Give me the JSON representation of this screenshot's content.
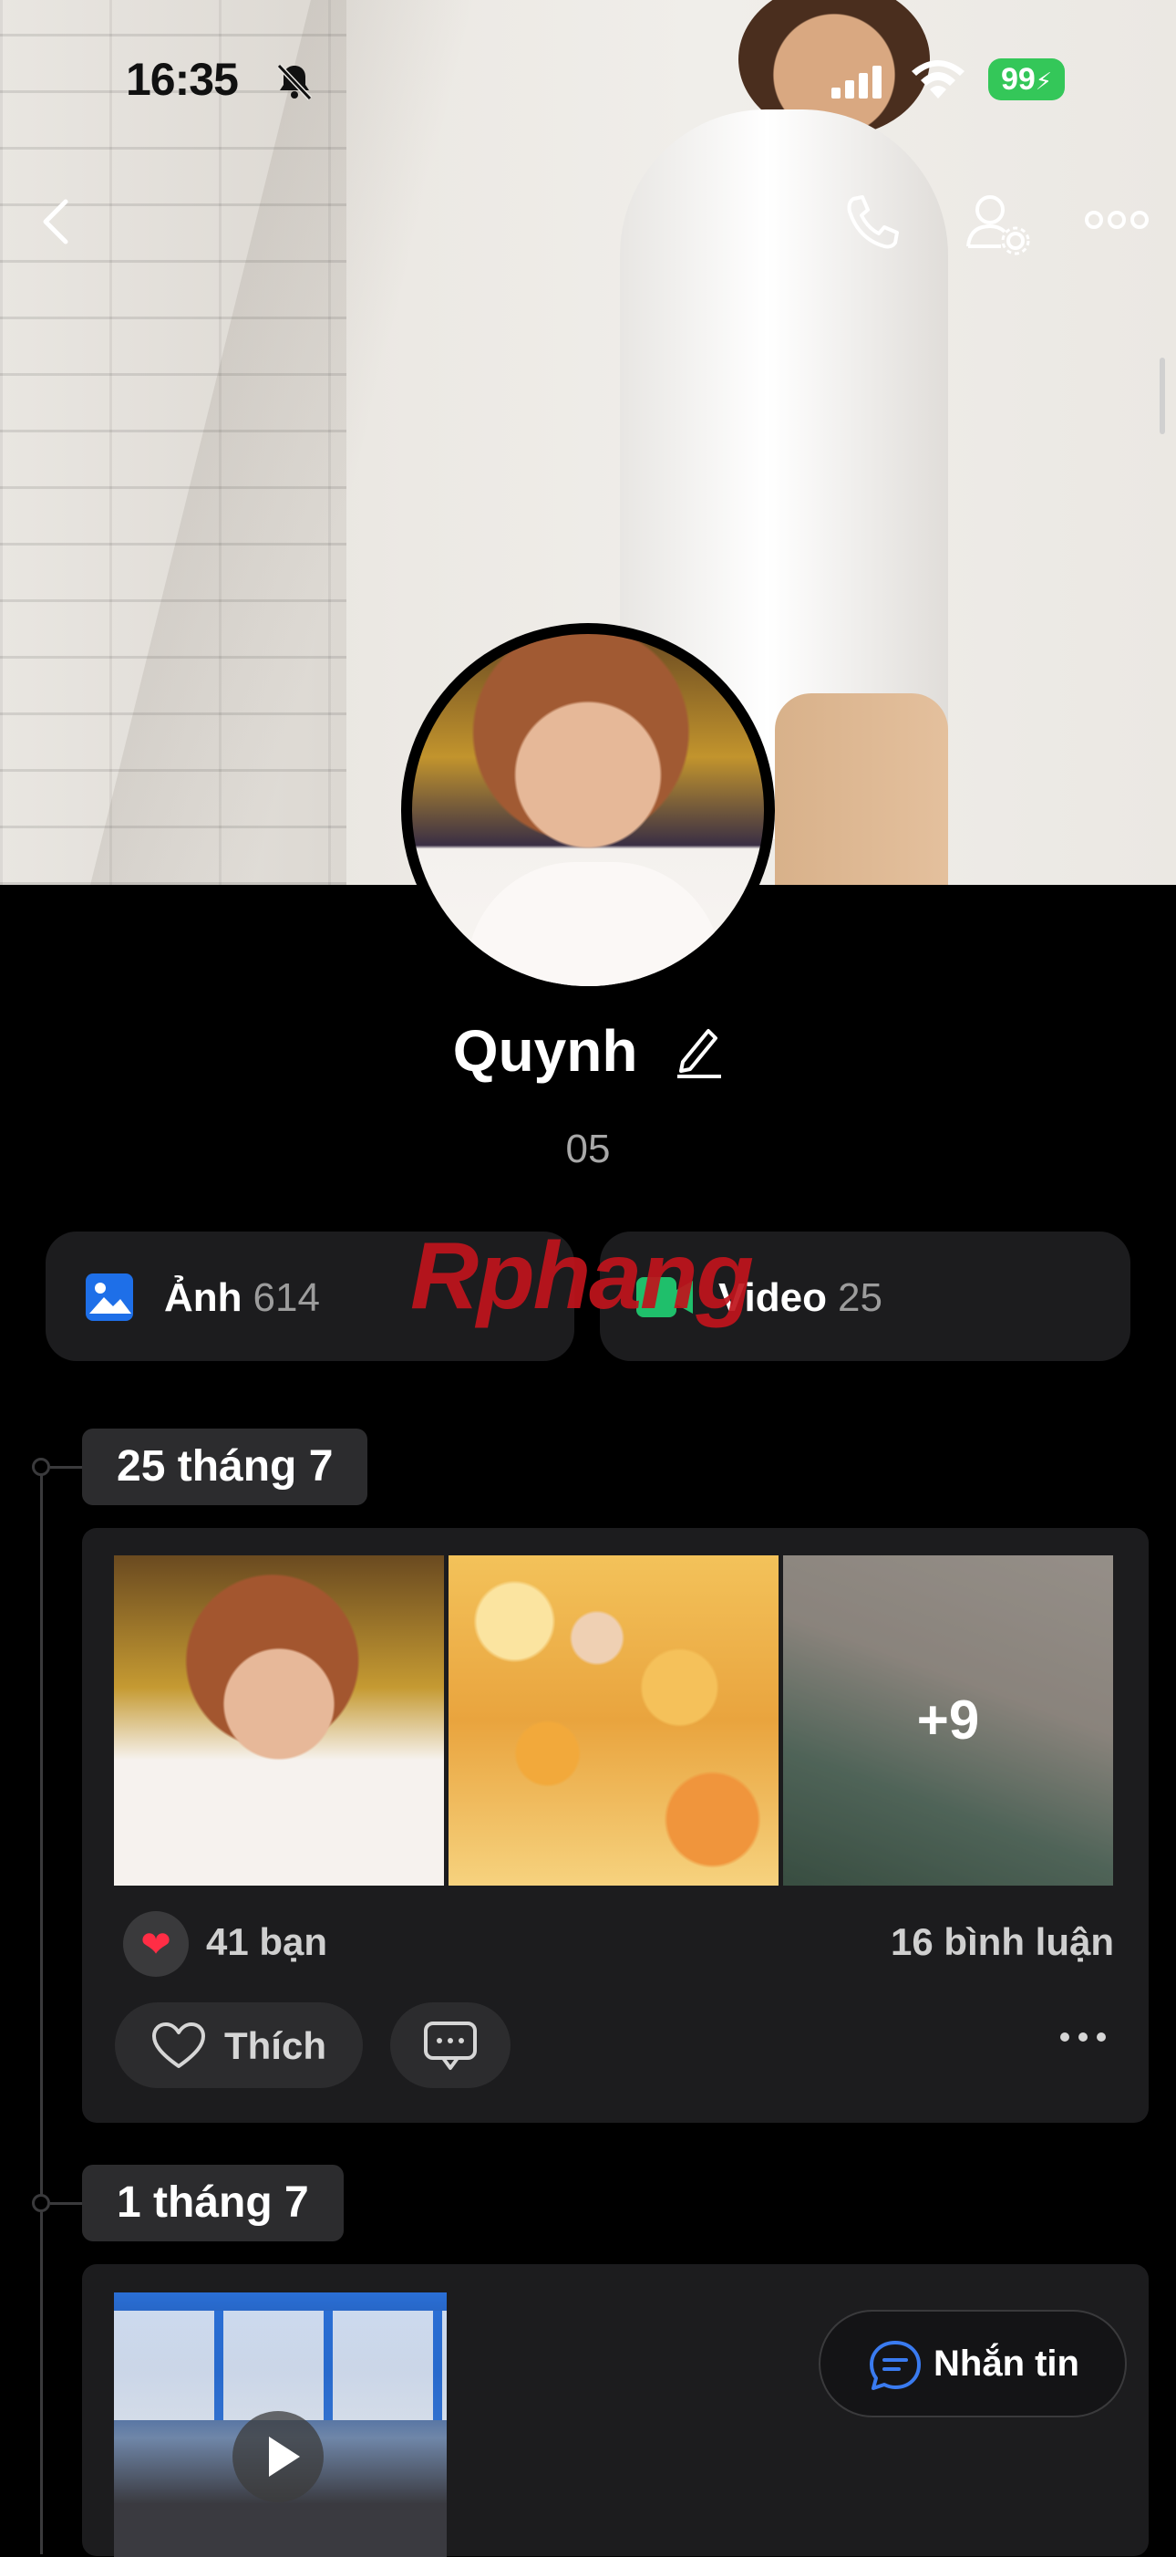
{
  "status_bar": {
    "time": "16:35",
    "battery": "99"
  },
  "profile": {
    "name": "Quynh",
    "subtitle": "05"
  },
  "media": {
    "photos_label": "Ảnh",
    "photos_count": "614",
    "videos_label": "Video",
    "videos_count": "25"
  },
  "watermark": {
    "part1": "Rphang",
    "part2": ""
  },
  "posts": [
    {
      "date": "25 tháng 7",
      "more_photos": "+9",
      "reactions": "41 bạn",
      "comments": "16 bình luận",
      "like_label": "Thích"
    },
    {
      "date": "1 tháng 7"
    }
  ],
  "message_button": {
    "label": "Nhắn tin"
  },
  "colors": {
    "background": "#000000",
    "card": "#1c1c1e",
    "chip": "#2c2c2e",
    "heart": "#ff2d45",
    "battery": "#34c759",
    "photo_icon": "#1e6fe8",
    "video_icon": "#1fbf6b",
    "message_icon": "#3a7bf0"
  },
  "icons": [
    "back-icon",
    "phone-icon",
    "user-settings-icon",
    "more-icon",
    "edit-icon",
    "photo-icon",
    "video-icon",
    "heart-icon",
    "comment-icon",
    "chat-icon",
    "play-icon",
    "bell-off-icon",
    "signal-icon",
    "wifi-icon"
  ]
}
